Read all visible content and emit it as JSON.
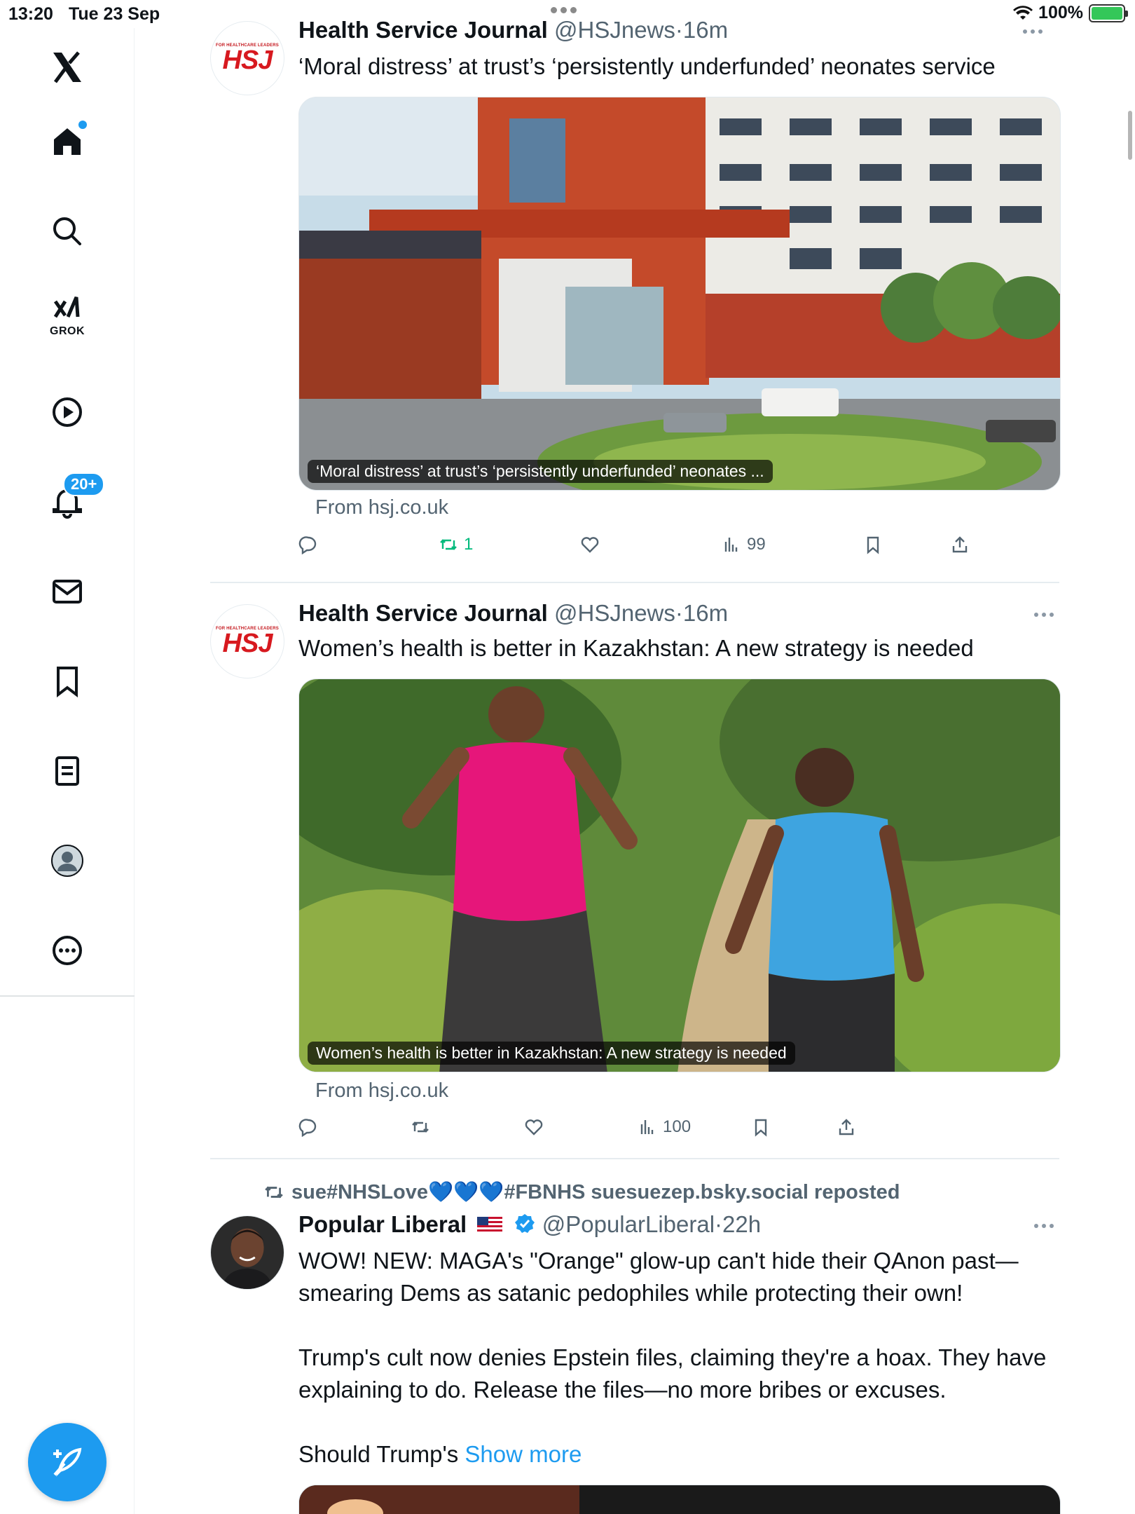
{
  "status_bar": {
    "time": "13:20",
    "date": "Tue 23 Sep",
    "battery": "100%"
  },
  "sidebar": {
    "grok_label": "GROK",
    "notifications_badge": "20+",
    "items": [
      "home-icon",
      "search-icon",
      "grok-icon",
      "video-icon",
      "bell-icon",
      "mail-icon",
      "bookmark-icon",
      "lists-icon",
      "profile-icon",
      "more-icon"
    ]
  },
  "colors": {
    "accent": "#1d9bf0",
    "retweet_active": "#00ba7c",
    "secondary_text": "#536471"
  },
  "feed": {
    "tweets": [
      {
        "name": "Health Service Journal",
        "handle": "@HSJnews",
        "time": "·16m",
        "avatar_logo": "HSJ",
        "avatar_tagline": "FOR HEALTHCARE LEADERS",
        "text": "‘Moral distress’ at trust’s ‘persistently underfunded’ neonates service",
        "media_caption": "‘Moral distress’ at trust’s ‘persistently underfunded’ neonates ...",
        "from": "From hsj.co.uk",
        "retweets": "1",
        "views": "99"
      },
      {
        "name": "Health Service Journal",
        "handle": "@HSJnews",
        "time": "·16m",
        "avatar_logo": "HSJ",
        "avatar_tagline": "FOR HEALTHCARE LEADERS",
        "text": "Women’s health is better in Kazakhstan: A new strategy is needed",
        "media_caption": "Women’s health is better in Kazakhstan: A new strategy is needed",
        "from": "From hsj.co.uk",
        "views": "100"
      },
      {
        "repost_by": "sue#NHSLove💙💙💙#FBNHS suesuezep.bsky.social reposted",
        "name": "Popular Liberal",
        "handle": "@PopularLiberal",
        "time": "·22h",
        "text_p1": "WOW! NEW: MAGA's \"Orange\" glow-up can't hide their QAnon past—smearing Dems as satanic pedophiles while protecting their own!",
        "text_p2": "Trump's cult now denies Epstein files, claiming they're a hoax. They have explaining to do. Release the files—no more bribes or excuses.",
        "text_p3": "Should Trump's",
        "show_more": "Show more"
      }
    ]
  }
}
